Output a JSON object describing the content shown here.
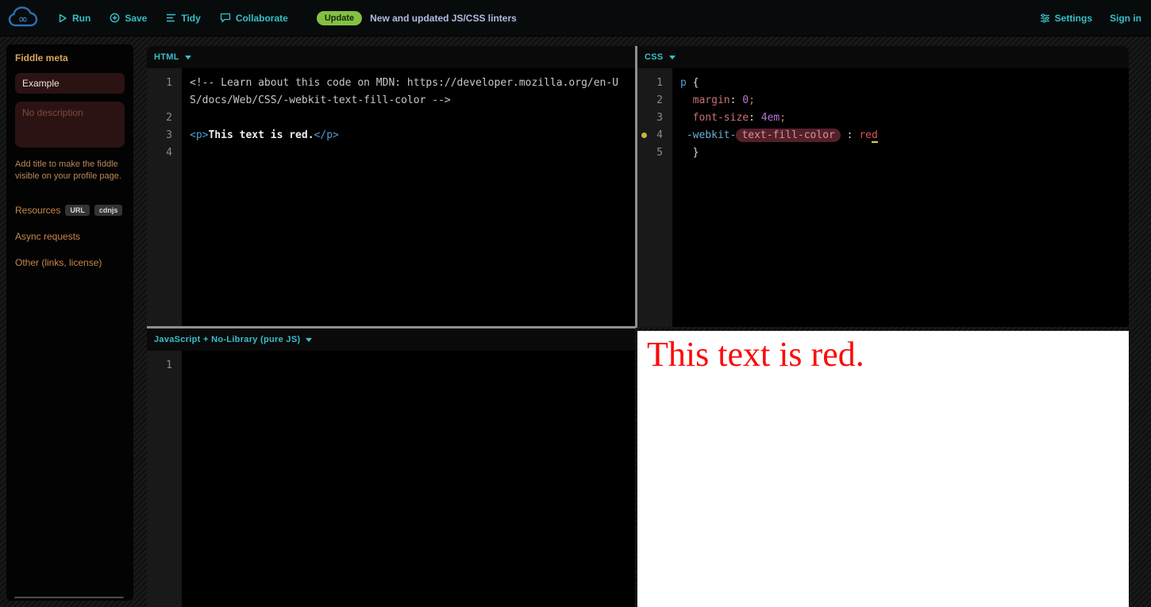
{
  "topbar": {
    "run_label": "Run",
    "save_label": "Save",
    "tidy_label": "Tidy",
    "collaborate_label": "Collaborate",
    "update_badge": "Update",
    "update_text": "New and updated JS/CSS linters",
    "settings_label": "Settings",
    "signin_label": "Sign in"
  },
  "colors": {
    "accent_teal": "#38bfc9",
    "badge_green": "#84c043",
    "sidebar_link_orange": "#c8884a",
    "result_text_red": "#fb0b0b",
    "lint_marker_yellow": "#c9b43a"
  },
  "sidebar": {
    "heading": "Fiddle meta",
    "title_value": "Example",
    "description_placeholder": "No description",
    "help_text": "Add title to make the fiddle visible on your profile page.",
    "links": [
      {
        "label": "Resources",
        "badges": [
          "URL",
          "cdnjs"
        ]
      },
      {
        "label": "Async requests",
        "badges": []
      },
      {
        "label": "Other (links, license)",
        "badges": []
      }
    ]
  },
  "editors": {
    "html": {
      "title": "HTML",
      "lines": [
        {
          "num": "1",
          "tokens": [
            {
              "t": "<!-- Learn about this code on MDN: https://developer.mozilla.org/en-US/docs/Web/CSS/-webkit-text-fill-color -->",
              "c": "comment"
            }
          ]
        },
        {
          "num": "2",
          "tokens": []
        },
        {
          "num": "3",
          "tokens": [
            {
              "t": "<p>",
              "c": "tag"
            },
            {
              "t": "This text is red.",
              "c": "text"
            },
            {
              "t": "</p>",
              "c": "tag"
            }
          ]
        },
        {
          "num": "4",
          "tokens": []
        }
      ]
    },
    "css": {
      "title": "CSS",
      "lines": [
        {
          "num": "1",
          "tokens": [
            {
              "t": "p",
              "c": "sel"
            },
            {
              "t": " {",
              "c": "brace"
            }
          ]
        },
        {
          "num": "2",
          "tokens": [
            {
              "t": "  ",
              "c": "brace"
            },
            {
              "t": "margin",
              "c": "prop"
            },
            {
              "t": ": ",
              "c": "brace"
            },
            {
              "t": "0",
              "c": "val"
            },
            {
              "t": ";",
              "c": "semi"
            }
          ]
        },
        {
          "num": "3",
          "tokens": [
            {
              "t": "  ",
              "c": "brace"
            },
            {
              "t": "font-size",
              "c": "prop"
            },
            {
              "t": ": ",
              "c": "brace"
            },
            {
              "t": "4em",
              "c": "val"
            },
            {
              "t": ";",
              "c": "semi"
            }
          ]
        },
        {
          "num": "4",
          "marker": true,
          "tokens": [
            {
              "t": " ",
              "c": "brace"
            },
            {
              "t": "-webkit-",
              "c": "key"
            },
            {
              "t": "text-fill-color",
              "c": "pill"
            },
            {
              "t": " : ",
              "c": "brace"
            },
            {
              "t": "re",
              "c": "red"
            },
            {
              "t": "d",
              "c": "red cursor"
            }
          ]
        },
        {
          "num": "5",
          "tokens": [
            {
              "t": "  }",
              "c": "brace"
            }
          ]
        }
      ]
    },
    "js": {
      "title": "JavaScript + No-Library (pure JS)",
      "lines": [
        {
          "num": "1",
          "tokens": []
        }
      ]
    }
  },
  "result": {
    "text": "This text is red."
  }
}
